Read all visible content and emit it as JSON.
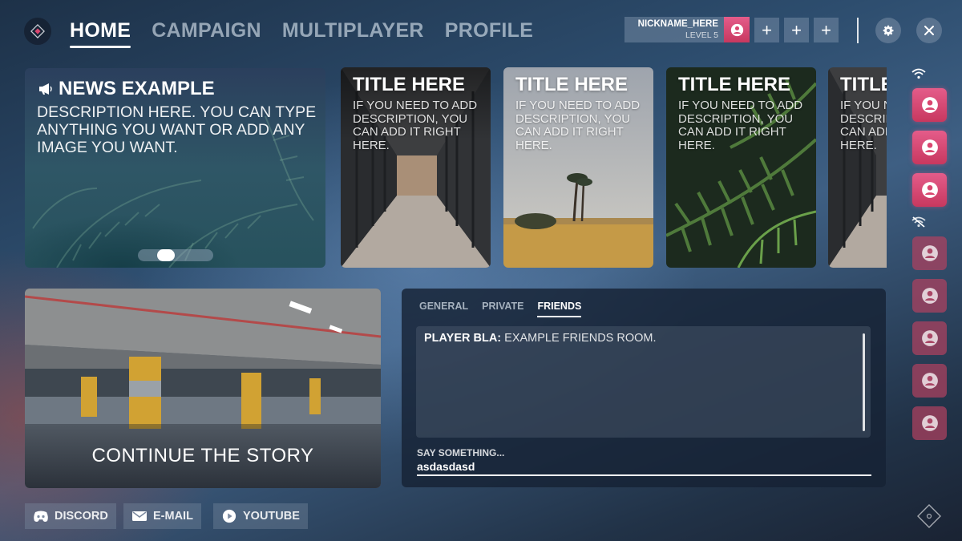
{
  "nav": {
    "tabs": [
      {
        "label": "HOME",
        "active": true
      },
      {
        "label": "CAMPAIGN",
        "active": false
      },
      {
        "label": "MULTIPLAYER",
        "active": false
      },
      {
        "label": "PROFILE",
        "active": false
      }
    ]
  },
  "user": {
    "nickname": "NICKNAME_HERE",
    "level": "LEVEL 5"
  },
  "party_slots": [
    "+",
    "+",
    "+"
  ],
  "news": {
    "title": "NEWS EXAMPLE",
    "description": "DESCRIPTION HERE. YOU CAN TYPE ANYTHING YOU WANT OR ADD ANY IMAGE YOU WANT."
  },
  "feature_cards": [
    {
      "title": "TITLE HERE",
      "description": "IF YOU NEED TO ADD DESCRIPTION, YOU CAN ADD IT RIGHT HERE."
    },
    {
      "title": "TITLE HERE",
      "description": "IF YOU NEED TO ADD DESCRIPTION, YOU CAN ADD IT RIGHT HERE."
    },
    {
      "title": "TITLE HERE",
      "description": "IF YOU NEED TO ADD DESCRIPTION, YOU CAN ADD IT RIGHT HERE."
    },
    {
      "title": "TITLE HERE",
      "description": "IF YOU NEED TO ADD DESCRIPTION, YOU CAN ADD IT RIGHT HERE."
    }
  ],
  "story": {
    "label": "CONTINUE THE STORY"
  },
  "chat": {
    "tabs": [
      {
        "label": "GENERAL",
        "active": false
      },
      {
        "label": "PRIVATE",
        "active": false
      },
      {
        "label": "FRIENDS",
        "active": true
      }
    ],
    "messages": [
      {
        "author": "PLAYER BLA:",
        "text": "EXAMPLE FRIENDS ROOM."
      }
    ],
    "input_label": "SAY SOMETHING...",
    "input_value": "asdasdasd"
  },
  "friends": {
    "online_icon": "wifi-icon",
    "offline_icon": "wifi-off-icon",
    "online_count": 3,
    "offline_count": 5
  },
  "links": [
    {
      "label": "DISCORD",
      "icon": "discord-icon"
    },
    {
      "label": "E-MAIL",
      "icon": "mail-icon"
    },
    {
      "label": "YOUTUBE",
      "icon": "play-icon"
    }
  ],
  "colors": {
    "accent_pink": "#d9466f",
    "panel": "#16223a"
  }
}
